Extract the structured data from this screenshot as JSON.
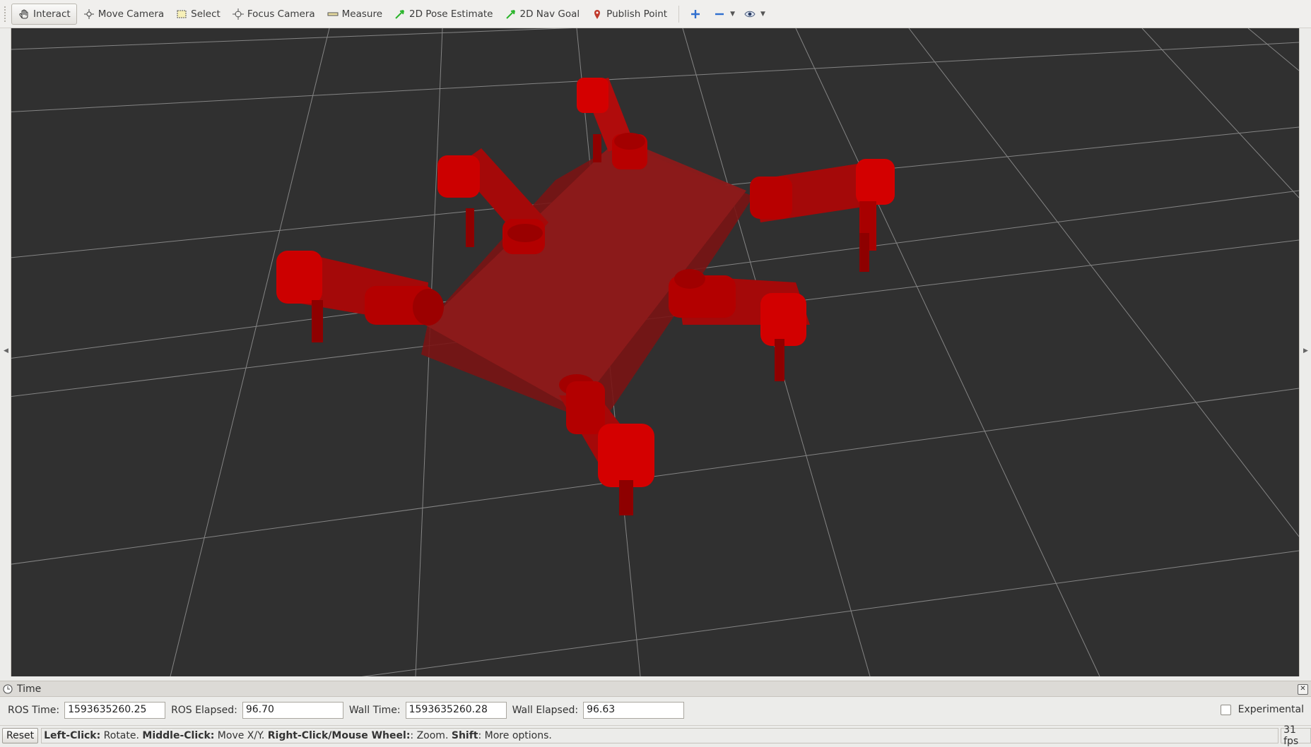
{
  "toolbar": {
    "tools": [
      {
        "label": "Interact",
        "icon": "hand-pointer-icon",
        "active": true
      },
      {
        "label": "Move Camera",
        "icon": "move-camera-icon"
      },
      {
        "label": "Select",
        "icon": "select-rect-icon"
      },
      {
        "label": "Focus Camera",
        "icon": "focus-crosshair-icon"
      },
      {
        "label": "Measure",
        "icon": "ruler-icon"
      },
      {
        "label": "2D Pose Estimate",
        "icon": "green-arrow-icon"
      },
      {
        "label": "2D Nav Goal",
        "icon": "green-arrow-icon"
      },
      {
        "label": "Publish Point",
        "icon": "map-pin-icon"
      }
    ],
    "extra_icons": [
      "add-tool-icon",
      "remove-tool-icon",
      "view-eye-icon"
    ]
  },
  "time_panel": {
    "title": "Time",
    "ros_time_label": "ROS Time:",
    "ros_time_value": "1593635260.25",
    "ros_elapsed_label": "ROS Elapsed:",
    "ros_elapsed_value": "96.70",
    "wall_time_label": "Wall Time:",
    "wall_time_value": "1593635260.28",
    "wall_elapsed_label": "Wall Elapsed:",
    "wall_elapsed_value": "96.63",
    "experimental_label": "Experimental",
    "experimental_checked": false
  },
  "status": {
    "reset_label": "Reset",
    "hint_parts": [
      {
        "text": "Left-Click:",
        "bold": true
      },
      {
        "text": " Rotate. ",
        "bold": false
      },
      {
        "text": "Middle-Click:",
        "bold": true
      },
      {
        "text": " Move X/Y. ",
        "bold": false
      },
      {
        "text": "Right-Click/Mouse Wheel:",
        "bold": true
      },
      {
        "text": ": Zoom. ",
        "bold": false
      },
      {
        "text": "Shift",
        "bold": true
      },
      {
        "text": ": More options.",
        "bold": false
      }
    ],
    "fps": "31 fps"
  },
  "colors": {
    "viewport_bg": "#303030",
    "grid_line": "#a0a0a0",
    "robot_red": "#c80000"
  }
}
